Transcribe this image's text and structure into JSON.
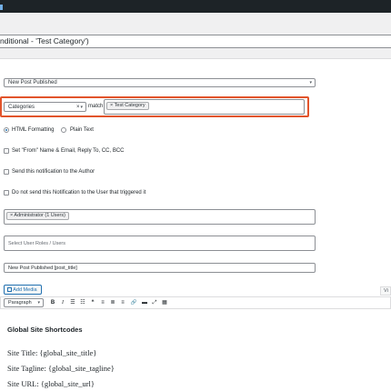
{
  "page": {
    "title": "nditional - 'Test Category')"
  },
  "trigger": {
    "selected": "New Post Published"
  },
  "condition": {
    "field": "Categories",
    "match_label": "match",
    "tag_remove": "×",
    "tag": "Test Category",
    "clear_icon": "×",
    "caret": "▾"
  },
  "format": {
    "html_label": "HTML Formatting",
    "plain_label": "Plain Text"
  },
  "options": {
    "from_label": "Set \"From\" Name & Email, Reply To, CC, BCC",
    "author_label": "Send this notification to the Author",
    "trigger_user_label": "Do not send this Notification to the User that triggered it"
  },
  "recipients": {
    "tag": "× Administrator (1 Users)",
    "roles_placeholder": "Select User Roles / Users"
  },
  "subject": {
    "value": "New Post Published [post_title]"
  },
  "editor": {
    "add_media": "Add Media",
    "visual_tab": "Vi",
    "paragraph": "Paragraph",
    "heading": "Global Site Shortcodes",
    "lines": [
      "Site Title: {global_site_title}",
      "Site Tagline: {global_site_tagline}",
      "Site URL: {global_site_url}"
    ]
  },
  "icons": {
    "bold": "B",
    "italic": "I",
    "bullets": "☰",
    "numbers": "☷",
    "quote": "❝",
    "align_left": "≡",
    "align_center": "≣",
    "align_right": "≡",
    "link": "🔗",
    "more": "▬",
    "fullscreen": "⤢",
    "kitchen": "▦"
  }
}
